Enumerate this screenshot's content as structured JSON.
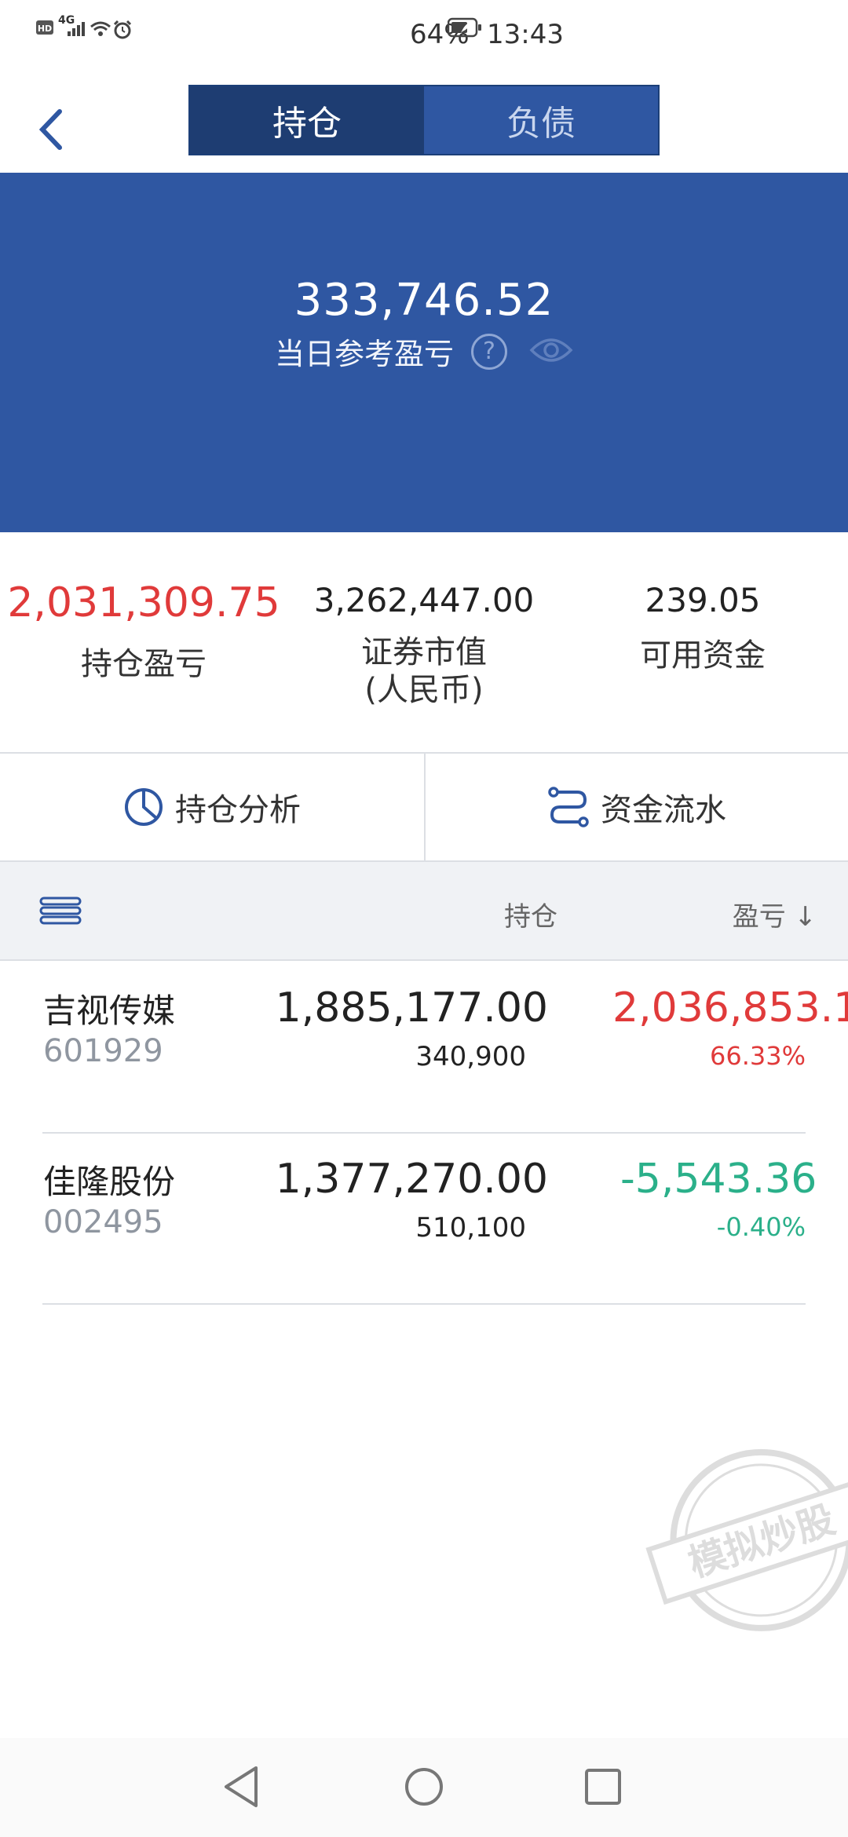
{
  "status_bar": {
    "time": "13:43",
    "battery_percent": "64%",
    "network": "4G",
    "icons": [
      "hd-icon",
      "signal-icon",
      "wifi-icon",
      "alarm-icon",
      "battery-icon"
    ]
  },
  "nav": {
    "back_icon": "chevron-left-icon",
    "tabs": [
      {
        "label": "持仓",
        "active": true
      },
      {
        "label": "负债",
        "active": false
      }
    ]
  },
  "summary": {
    "value": "333,746.52",
    "label": "当日参考盈亏",
    "help_symbol": "?",
    "eye_icon": "eye-icon"
  },
  "stats": [
    {
      "value": "2,031,309.75",
      "label": "持仓盈亏"
    },
    {
      "value": "3,262,447.00",
      "label_line1": "证券市值",
      "label_line2": "(人民币)"
    },
    {
      "value": "239.05",
      "label": "可用资金"
    }
  ],
  "actions": [
    {
      "label": "持仓分析",
      "icon": "pie-chart-icon"
    },
    {
      "label": "资金流水",
      "icon": "flow-icon"
    }
  ],
  "table": {
    "header": {
      "holdings": "持仓",
      "pl": "盈亏 ↓",
      "menu_icon": "menu-icon"
    },
    "rows": [
      {
        "name": "吉视传媒",
        "code": "601929",
        "market_value": "1,885,177.00",
        "quantity": "340,900",
        "pl": "2,036,853.1",
        "pl_pct": "66.33%",
        "direction": "up"
      },
      {
        "name": "佳隆股份",
        "code": "002495",
        "market_value": "1,377,270.00",
        "quantity": "510,100",
        "pl": "-5,543.36",
        "pl_pct": "-0.40%",
        "direction": "down"
      }
    ]
  },
  "watermark": {
    "text": "模拟炒股"
  },
  "colors": {
    "brand_blue": "#2f57a2",
    "dark_blue": "#1e3d72",
    "up_red": "#e03a3a",
    "down_green": "#2bb08a"
  }
}
